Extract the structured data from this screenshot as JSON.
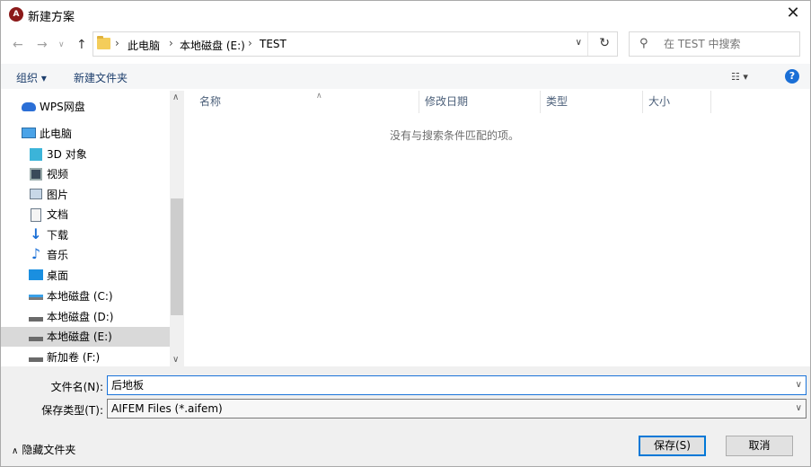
{
  "window": {
    "title": "新建方案",
    "app_icon_glyph": "A"
  },
  "address": {
    "crumbs": [
      "此电脑",
      "本地磁盘 (E:)",
      "TEST"
    ],
    "separator": "›"
  },
  "search": {
    "placeholder": "在 TEST 中搜索"
  },
  "toolbar": {
    "organize": "组织 ▾",
    "new_folder": "新建文件夹",
    "help": "?"
  },
  "nav": {
    "items": [
      {
        "label": "WPS网盘",
        "icon": "cloud-icon"
      },
      {
        "label": "此电脑",
        "icon": "computer-icon"
      },
      {
        "label": "3D 对象",
        "icon": "cube-icon"
      },
      {
        "label": "视频",
        "icon": "video-icon"
      },
      {
        "label": "图片",
        "icon": "pictures-icon"
      },
      {
        "label": "文档",
        "icon": "documents-icon"
      },
      {
        "label": "下载",
        "icon": "download-icon"
      },
      {
        "label": "音乐",
        "icon": "music-icon"
      },
      {
        "label": "桌面",
        "icon": "desktop-icon"
      },
      {
        "label": "本地磁盘 (C:)",
        "icon": "drive-icon"
      },
      {
        "label": "本地磁盘 (D:)",
        "icon": "drive-icon"
      },
      {
        "label": "本地磁盘 (E:)",
        "icon": "drive-icon"
      },
      {
        "label": "新加卷 (F:)",
        "icon": "drive-icon"
      }
    ],
    "selected": "本地磁盘 (E:)"
  },
  "filelist": {
    "columns": [
      "名称",
      "修改日期",
      "类型",
      "大小"
    ],
    "empty_message": "没有与搜索条件匹配的项。"
  },
  "form": {
    "filename_label": "文件名(N):",
    "filename_value": "后地板",
    "filetype_label": "保存类型(T):",
    "filetype_value": "AIFEM Files (*.aifem)"
  },
  "footer": {
    "hide_folders": "隐藏文件夹",
    "save_label": "保存(S)",
    "cancel_label": "取消"
  },
  "colors": {
    "accent": "#0078d7",
    "help": "#1a6fd6",
    "app_icon": "#8b1a1a",
    "selected_bg": "#d9d9d9"
  }
}
